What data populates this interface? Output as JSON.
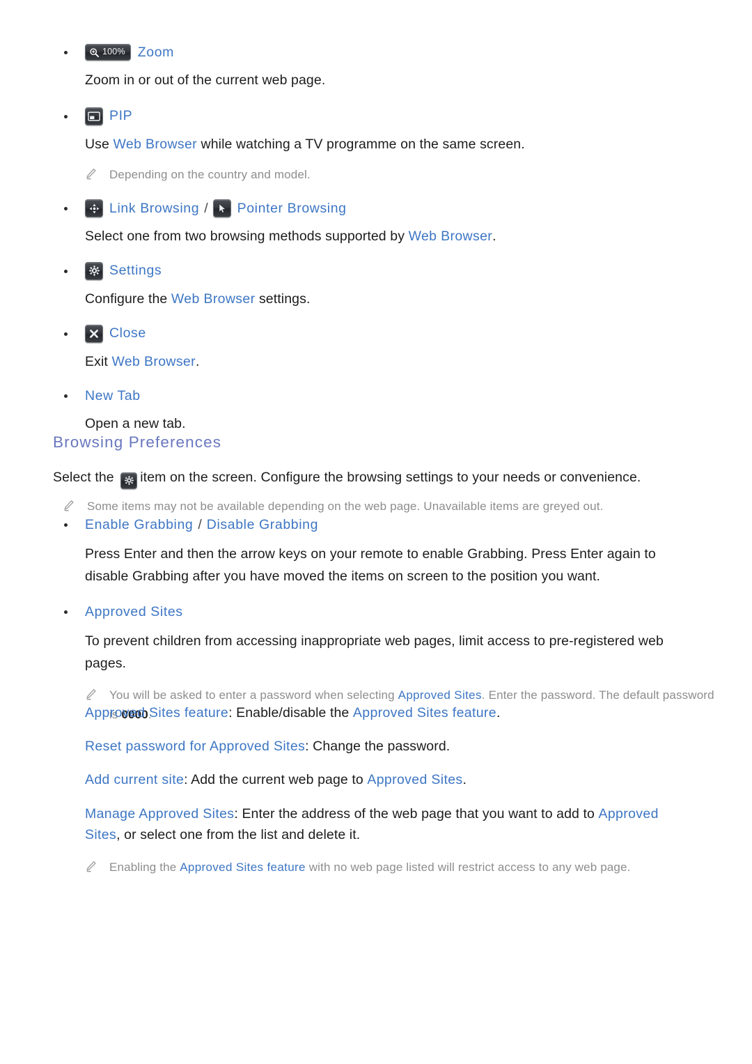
{
  "page": {
    "background": "#ffffff",
    "link_color": "#3d76c4",
    "heading_color": "#6977bf",
    "note_color": "#8d8d8d",
    "body_color": "#1c1c1c"
  },
  "browser_menu": {
    "items": [
      {
        "icon": "zoom-icon",
        "icon_label": "100%",
        "label": "Zoom",
        "description": "Zoom in or out of the current web page.",
        "note": null
      },
      {
        "icon": "pip-icon",
        "label": "PIP",
        "description_parts": [
          {
            "text": "Use ",
            "style": "plain"
          },
          {
            "text": "Web Browser",
            "style": "link"
          },
          {
            "text": " while watching a TV programme on the same screen.",
            "style": "plain"
          }
        ],
        "note": "Depending on the country and model."
      },
      {
        "icon": "dpad-icon",
        "label": "Link Browsing",
        "separator": "/",
        "icon2": "pointer-icon",
        "label2": "Pointer Browsing",
        "description_parts": [
          {
            "text": "Select one from two browsing methods supported by ",
            "style": "plain"
          },
          {
            "text": "Web Browser",
            "style": "link"
          },
          {
            "text": ".",
            "style": "plain"
          }
        ]
      },
      {
        "icon": "gear-icon",
        "label": "Settings",
        "description_parts": [
          {
            "text": "Configure the ",
            "style": "plain"
          },
          {
            "text": "Web Browser",
            "style": "link"
          },
          {
            "text": " settings.",
            "style": "plain"
          }
        ]
      },
      {
        "icon": "close-icon",
        "label": "Close",
        "description_parts": [
          {
            "text": "Exit ",
            "style": "plain"
          },
          {
            "text": "Web Browser",
            "style": "link"
          },
          {
            "text": ".",
            "style": "plain"
          }
        ]
      },
      {
        "icon": null,
        "label": "New Tab",
        "description": "Open a new tab."
      }
    ]
  },
  "browsing_preferences": {
    "title": "Browsing Preferences",
    "intro_before_icon": "Select the ",
    "intro_icon": "gear-icon",
    "intro_after_icon": "item on the screen. Configure the browsing settings to your needs or convenience.",
    "intro_note": "Some items may not be available depending on the web page. Unavailable items are greyed out.",
    "items": [
      {
        "label": "Enable Grabbing",
        "separator": "/",
        "label2": "Disable Grabbing",
        "description": "Press Enter and then the arrow keys on your remote to enable Grabbing. Press Enter again to disable Grabbing after you have moved the items on screen to the position you want."
      },
      {
        "label": "Approved Sites",
        "description": "To prevent children from accessing inappropriate web pages, limit access to pre-registered web pages.",
        "note_parts": [
          {
            "text": "You will be asked to enter a password when selecting ",
            "style": "plain"
          },
          {
            "text": "Approved Sites",
            "style": "link"
          },
          {
            "text": ". Enter the password. The default password is ",
            "style": "plain"
          },
          {
            "text": "0000",
            "style": "bold"
          },
          {
            "text": ".",
            "style": "plain"
          }
        ]
      }
    ],
    "sub_items": [
      {
        "parts": [
          {
            "text": "Approved Sites feature",
            "style": "link"
          },
          {
            "text": ": Enable/disable the ",
            "style": "plain"
          },
          {
            "text": "Approved Sites feature",
            "style": "link"
          },
          {
            "text": ".",
            "style": "plain"
          }
        ]
      },
      {
        "parts": [
          {
            "text": "Reset password for Approved Sites",
            "style": "link"
          },
          {
            "text": ": Change the password.",
            "style": "plain"
          }
        ]
      },
      {
        "parts": [
          {
            "text": "Add current site",
            "style": "link"
          },
          {
            "text": ": Add the current web page to ",
            "style": "plain"
          },
          {
            "text": "Approved Sites",
            "style": "link"
          },
          {
            "text": ".",
            "style": "plain"
          }
        ]
      },
      {
        "parts": [
          {
            "text": "Manage Approved Sites",
            "style": "link"
          },
          {
            "text": ": Enter the address of the web page that you want to add to ",
            "style": "plain"
          },
          {
            "text": "Approved Sites",
            "style": "link"
          },
          {
            "text": ", or select one from the list and delete it.",
            "style": "plain"
          }
        ]
      }
    ],
    "final_note_parts": [
      {
        "text": "Enabling the ",
        "style": "plain"
      },
      {
        "text": "Approved Sites feature",
        "style": "link"
      },
      {
        "text": " with no web page listed will restrict access to any web page.",
        "style": "plain"
      }
    ]
  }
}
